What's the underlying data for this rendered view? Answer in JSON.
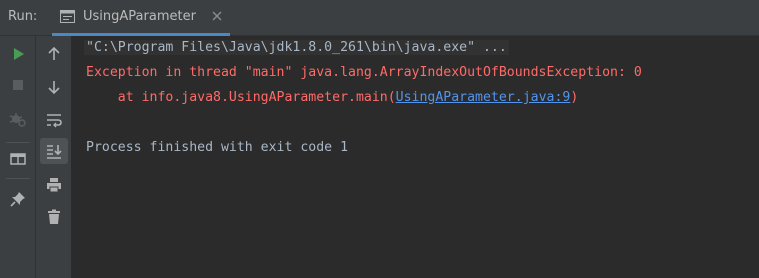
{
  "tabbar": {
    "run_label": "Run:",
    "tab_title": "UsingAParameter",
    "tab_icon": "application-window-icon",
    "close_icon": "close-icon"
  },
  "left_toolbar": {
    "items": [
      "rerun-icon",
      "stop-icon",
      "debug-disabled-icon",
      "layout-icon",
      "pin-icon"
    ]
  },
  "second_toolbar": {
    "items": [
      "up-arrow-icon",
      "down-arrow-icon",
      "soft-wrap-icon",
      "scroll-to-end-icon",
      "print-icon",
      "trash-icon"
    ]
  },
  "console": {
    "command": "\"C:\\Program Files\\Java\\jdk1.8.0_261\\bin\\java.exe\" ...",
    "exception": "Exception in thread \"main\" java.lang.ArrayIndexOutOfBoundsException: 0",
    "stack_prefix": "    at info.java8.UsingAParameter.main(",
    "stack_link": "UsingAParameter.java:9",
    "stack_suffix": ")",
    "exit_message": "Process finished with exit code 1"
  },
  "colors": {
    "background": "#2b2b2b",
    "panel": "#3c3f41",
    "error": "#ff6b68",
    "link": "#5394ec",
    "text": "#a9b7c6",
    "run_green": "#499c54"
  }
}
